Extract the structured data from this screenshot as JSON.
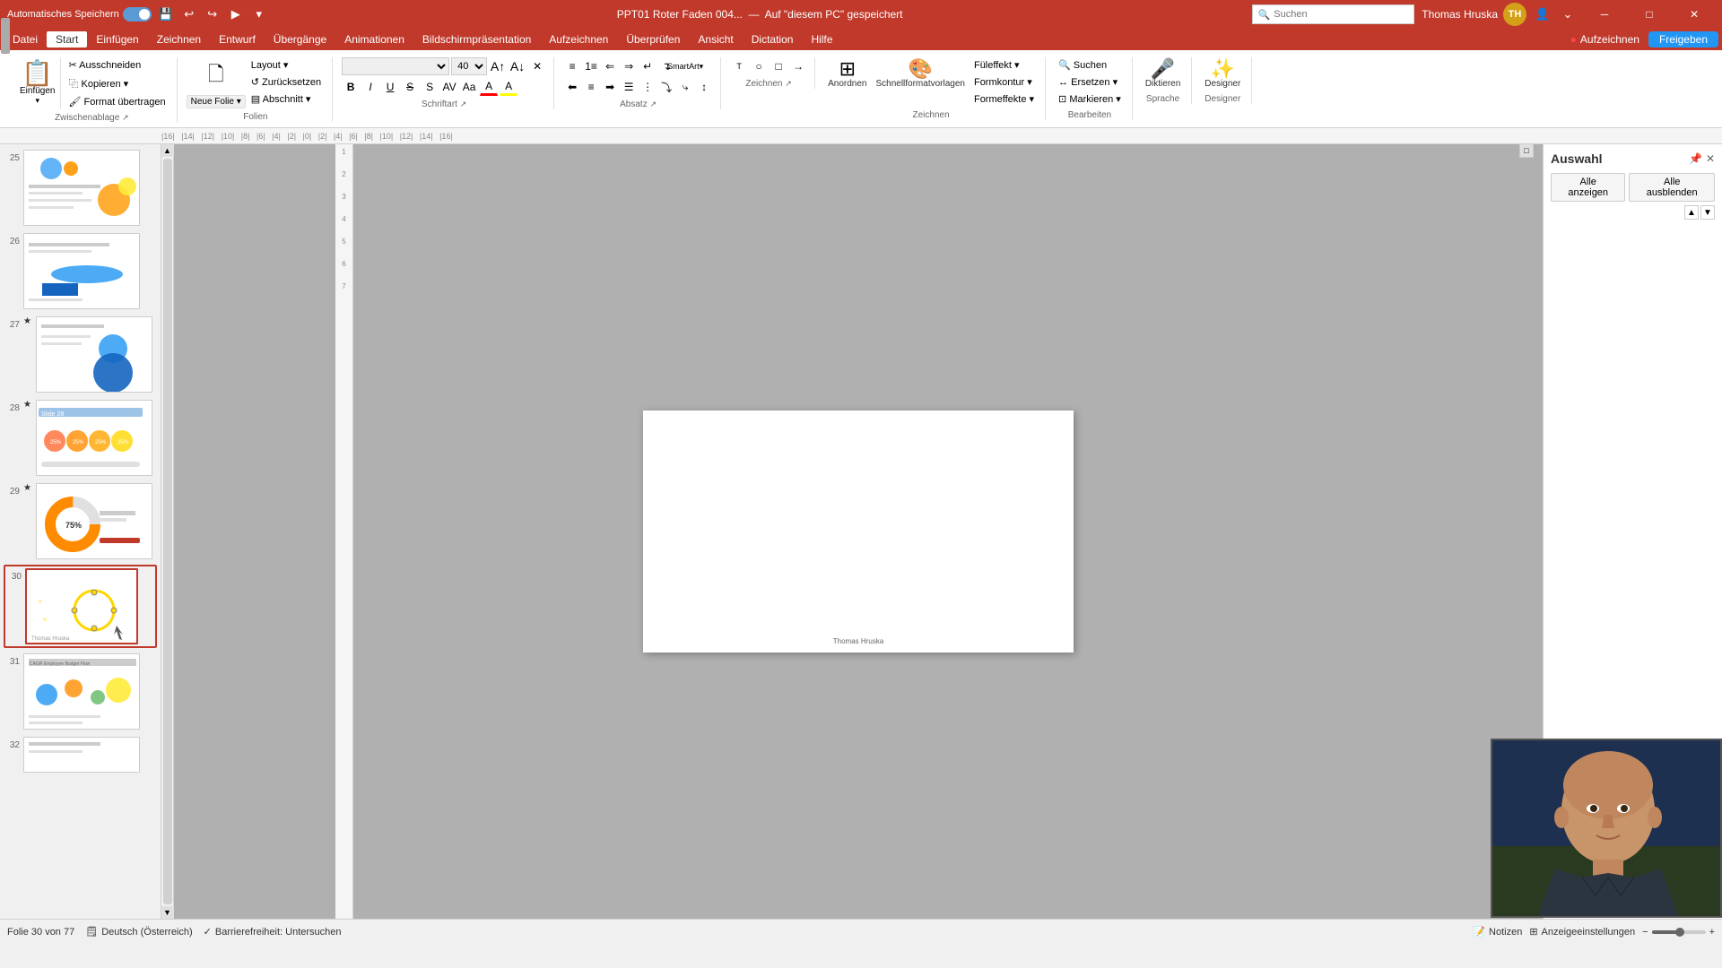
{
  "titleBar": {
    "autosave_label": "Automatisches Speichern",
    "autosave_on": true,
    "file_name": "PPT01 Roter Faden 004...",
    "save_location": "Auf \"diesem PC\" gespeichert",
    "search_placeholder": "Suchen",
    "user_name": "Thomas Hruska",
    "user_initials": "TH",
    "window_controls": [
      "─",
      "□",
      "✕"
    ]
  },
  "menuBar": {
    "items": [
      "Datei",
      "Start",
      "Einfügen",
      "Zeichnen",
      "Entwurf",
      "Übergänge",
      "Animationen",
      "Bildschirmpräsentation",
      "Aufzeichnen",
      "Überprüfen",
      "Ansicht",
      "Dictation",
      "Hilfe"
    ],
    "active": "Start",
    "right_items": [
      "Aufzeichnen",
      "Freigeben"
    ]
  },
  "ribbon": {
    "groups": {
      "clipboard": {
        "label": "Zwischenablage",
        "paste_label": "Einfügen",
        "items": [
          "Ausschneiden",
          "Kopieren",
          "Format übertragen"
        ]
      },
      "slides": {
        "label": "Folien",
        "new_slide": "Neue Folie",
        "items": [
          "Layout",
          "Zurücksetzen",
          "Abschnitt"
        ]
      },
      "font": {
        "label": "Schriftart",
        "font_name": "",
        "font_size": "40",
        "items": [
          "F",
          "K",
          "U",
          "S"
        ]
      },
      "paragraph": {
        "label": "Absatz"
      },
      "drawing": {
        "label": "Zeichnen"
      },
      "arrange": {
        "label": "Anordnen",
        "items": [
          "Anordnen",
          "Schnellformat­vorlagen"
        ]
      },
      "edit": {
        "label": "Bearbeiten",
        "items": [
          "Suchen",
          "Ersetzen",
          "Markieren"
        ]
      },
      "speak": {
        "label": "Sprache",
        "dictate_label": "Diktieren"
      },
      "designer": {
        "label": "Designer",
        "designer_label": "Designer"
      }
    }
  },
  "slides": [
    {
      "num": "25",
      "star": false,
      "active": false
    },
    {
      "num": "26",
      "star": false,
      "active": false
    },
    {
      "num": "27",
      "star": true,
      "active": false
    },
    {
      "num": "28",
      "star": true,
      "active": false
    },
    {
      "num": "29",
      "star": true,
      "active": false
    },
    {
      "num": "30",
      "star": false,
      "active": true
    },
    {
      "num": "31",
      "star": false,
      "active": false
    },
    {
      "num": "32",
      "star": false,
      "active": false
    }
  ],
  "mainSlide": {
    "author": "Thomas Hruska",
    "content": ""
  },
  "rightPanel": {
    "title": "Auswahl",
    "btn_show_all": "Alle anzeigen",
    "btn_hide_all": "Alle ausblenden"
  },
  "statusBar": {
    "slide_info": "Folie 30 von 77",
    "language": "Deutsch (Österreich)",
    "accessibility": "Barrierefreiheit: Untersuchen",
    "notes": "Notizen",
    "comments": "Anzeigeeinstellungen"
  }
}
